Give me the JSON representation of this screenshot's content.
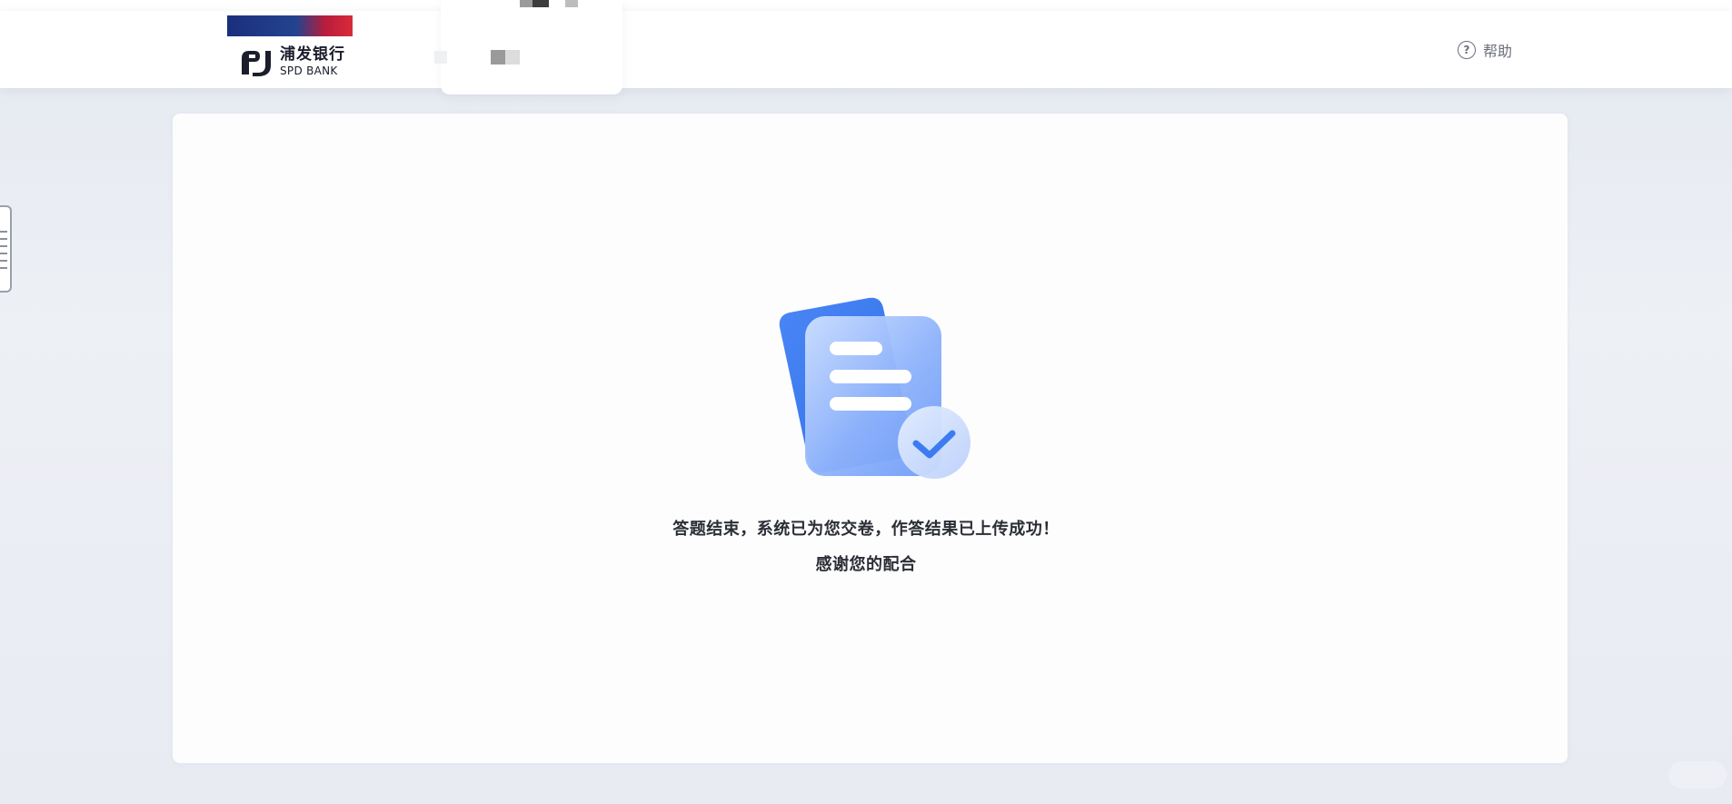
{
  "header": {
    "logo": {
      "name_cn": "浦发银行",
      "name_en": "SPD BANK",
      "mark_icon": "spd-bank-logo-icon"
    },
    "help": {
      "label": "帮助",
      "icon": "question-circle-icon"
    }
  },
  "main": {
    "illustration_icon": "document-check-icon",
    "message_line1": "答题结束，系统已为您交卷，作答结果已上传成功！",
    "message_line2": "感谢您的配合"
  },
  "colors": {
    "brand_blue": "#1b2f7c",
    "brand_red": "#d92b3a",
    "illustration_blue": "#3d7cf0",
    "page_background": "#e9ecf3",
    "card_background": "#fdfdfe",
    "text_primary": "#2b2e36",
    "text_secondary": "#6b6f7a"
  }
}
